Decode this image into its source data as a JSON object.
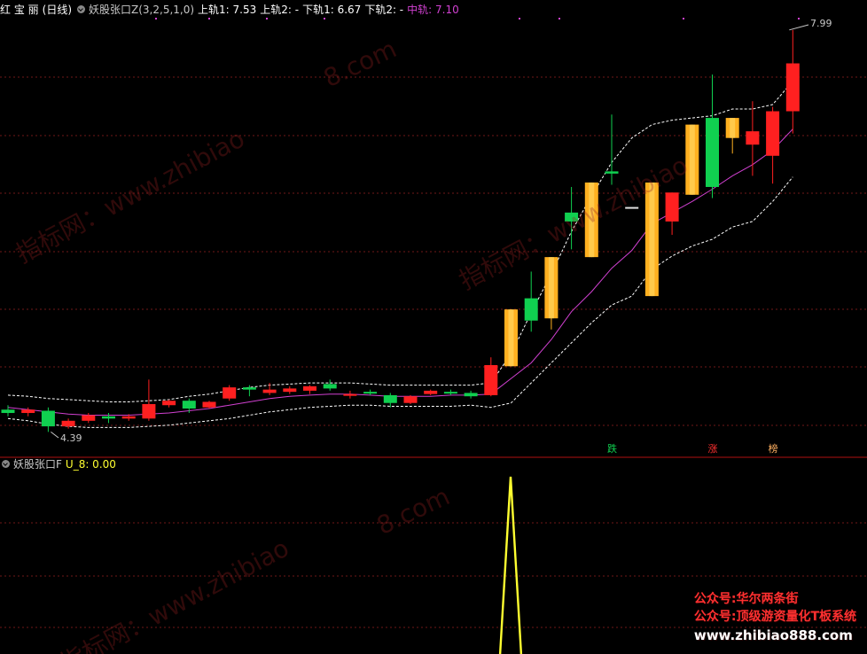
{
  "colors": {
    "up": "#ff2020",
    "down": "#10d050",
    "limit_up": "#ffb020",
    "mid": "#d040d0",
    "band": "#ffffff",
    "grid": "#701818",
    "divider": "#b01010",
    "signal_line": "#ffff30",
    "label_grey": "#c8c8c8"
  },
  "main_header": {
    "stock_name": "红 宝 丽",
    "period": "(日线)",
    "indicator": "妖股张口Z(3,2,5,1,0)",
    "upper1": "上轨1: 7.53",
    "upper2": "上轨2: -",
    "lower1": "下轨1: 6.67",
    "lower2": "下轨2: -",
    "mid": "中轨: 7.10"
  },
  "sub_header": {
    "indicator": "妖股张口F",
    "value": "U_8: 0.00"
  },
  "price_labels": {
    "high": "7.99",
    "low": "4.39"
  },
  "signals": [
    {
      "text": "跌",
      "color": "#10d050",
      "candle": 30
    },
    {
      "text": "涨",
      "color": "#ff3030",
      "candle": 35
    },
    {
      "text": "榜",
      "color": "#ffb060",
      "candle": 38
    }
  ],
  "watermarks": [
    "指标网：www.zhibiao",
    "8.com"
  ],
  "promo": [
    {
      "text": "公众号:华尔两条街",
      "color": "#ff3030"
    },
    {
      "text": "公众号:顶级游资量化T板系统",
      "color": "#ff3030"
    },
    {
      "text": "www.zhibiao888.com",
      "color": "#ffffff"
    }
  ],
  "chart_data": {
    "type": "candlestick",
    "ylim": [
      4.2,
      8.1
    ],
    "candles": [
      {
        "o": 4.58,
        "h": 4.62,
        "l": 4.52,
        "c": 4.55,
        "t": "down"
      },
      {
        "o": 4.55,
        "h": 4.6,
        "l": 4.52,
        "c": 4.58,
        "t": "up"
      },
      {
        "o": 4.57,
        "h": 4.6,
        "l": 4.38,
        "c": 4.43,
        "t": "down"
      },
      {
        "o": 4.43,
        "h": 4.5,
        "l": 4.41,
        "c": 4.48,
        "t": "up"
      },
      {
        "o": 4.48,
        "h": 4.55,
        "l": 4.46,
        "c": 4.53,
        "t": "up"
      },
      {
        "o": 4.52,
        "h": 4.55,
        "l": 4.46,
        "c": 4.5,
        "t": "down"
      },
      {
        "o": 4.5,
        "h": 4.54,
        "l": 4.48,
        "c": 4.52,
        "t": "up"
      },
      {
        "o": 4.5,
        "h": 4.85,
        "l": 4.48,
        "c": 4.63,
        "t": "up"
      },
      {
        "o": 4.62,
        "h": 4.67,
        "l": 4.6,
        "c": 4.66,
        "t": "up"
      },
      {
        "o": 4.66,
        "h": 4.68,
        "l": 4.55,
        "c": 4.59,
        "t": "down"
      },
      {
        "o": 4.6,
        "h": 4.66,
        "l": 4.59,
        "c": 4.65,
        "t": "up"
      },
      {
        "o": 4.68,
        "h": 4.8,
        "l": 4.66,
        "c": 4.78,
        "t": "up"
      },
      {
        "o": 4.78,
        "h": 4.8,
        "l": 4.7,
        "c": 4.76,
        "t": "down"
      },
      {
        "o": 4.73,
        "h": 4.82,
        "l": 4.71,
        "c": 4.76,
        "t": "up"
      },
      {
        "o": 4.74,
        "h": 4.79,
        "l": 4.72,
        "c": 4.77,
        "t": "up"
      },
      {
        "o": 4.75,
        "h": 4.8,
        "l": 4.72,
        "c": 4.79,
        "t": "up"
      },
      {
        "o": 4.81,
        "h": 4.85,
        "l": 4.75,
        "c": 4.77,
        "t": "down"
      },
      {
        "o": 4.72,
        "h": 4.75,
        "l": 4.68,
        "c": 4.71,
        "t": "up"
      },
      {
        "o": 4.73,
        "h": 4.76,
        "l": 4.71,
        "c": 4.74,
        "t": "down"
      },
      {
        "o": 4.71,
        "h": 4.73,
        "l": 4.6,
        "c": 4.64,
        "t": "down"
      },
      {
        "o": 4.64,
        "h": 4.71,
        "l": 4.63,
        "c": 4.7,
        "t": "up"
      },
      {
        "o": 4.72,
        "h": 4.76,
        "l": 4.71,
        "c": 4.75,
        "t": "up"
      },
      {
        "o": 4.74,
        "h": 4.76,
        "l": 4.71,
        "c": 4.73,
        "t": "down"
      },
      {
        "o": 4.73,
        "h": 4.75,
        "l": 4.68,
        "c": 4.7,
        "t": "down"
      },
      {
        "o": 4.71,
        "h": 5.05,
        "l": 4.7,
        "c": 4.98,
        "t": "up"
      },
      {
        "o": 4.97,
        "h": 5.48,
        "l": 4.97,
        "c": 5.48,
        "t": "limit"
      },
      {
        "o": 5.38,
        "h": 5.82,
        "l": 5.28,
        "c": 5.58,
        "t": "down"
      },
      {
        "o": 5.4,
        "h": 5.95,
        "l": 5.3,
        "c": 5.95,
        "t": "limit"
      },
      {
        "o": 6.27,
        "h": 6.58,
        "l": 6.02,
        "c": 6.35,
        "t": "down"
      },
      {
        "o": 5.95,
        "h": 6.62,
        "l": 5.95,
        "c": 6.62,
        "t": "limit"
      },
      {
        "o": 6.7,
        "h": 7.23,
        "l": 6.6,
        "c": 6.72,
        "t": "down"
      },
      {
        "o": 6.4,
        "h": 6.4,
        "l": 6.4,
        "c": 6.4,
        "t": "flat"
      },
      {
        "o": 5.6,
        "h": 6.62,
        "l": 5.6,
        "c": 6.62,
        "t": "limit"
      },
      {
        "o": 6.27,
        "h": 6.53,
        "l": 6.15,
        "c": 6.53,
        "t": "up"
      },
      {
        "o": 6.51,
        "h": 7.14,
        "l": 6.51,
        "c": 7.14,
        "t": "limit"
      },
      {
        "o": 7.2,
        "h": 7.59,
        "l": 6.48,
        "c": 6.58,
        "t": "down"
      },
      {
        "o": 7.02,
        "h": 7.2,
        "l": 6.88,
        "c": 7.2,
        "t": "limit"
      },
      {
        "o": 7.08,
        "h": 7.35,
        "l": 6.68,
        "c": 6.96,
        "t": "up"
      },
      {
        "o": 6.86,
        "h": 7.3,
        "l": 6.61,
        "c": 7.26,
        "t": "up"
      },
      {
        "o": 7.26,
        "h": 7.99,
        "l": 7.06,
        "c": 7.69,
        "t": "up"
      }
    ],
    "mid_band": [
      4.6,
      4.58,
      4.56,
      4.54,
      4.53,
      4.53,
      4.53,
      4.54,
      4.55,
      4.57,
      4.59,
      4.62,
      4.65,
      4.68,
      4.7,
      4.71,
      4.72,
      4.72,
      4.71,
      4.7,
      4.7,
      4.7,
      4.71,
      4.71,
      4.72,
      4.86,
      5.0,
      5.21,
      5.46,
      5.64,
      5.85,
      6.01,
      6.25,
      6.35,
      6.45,
      6.56,
      6.68,
      6.78,
      6.91,
      7.1
    ],
    "upper_band": [
      4.71,
      4.7,
      4.68,
      4.67,
      4.66,
      4.65,
      4.65,
      4.66,
      4.67,
      4.7,
      4.72,
      4.75,
      4.78,
      4.8,
      4.81,
      4.82,
      4.82,
      4.82,
      4.81,
      4.8,
      4.8,
      4.8,
      4.8,
      4.8,
      4.82,
      5.08,
      5.45,
      5.8,
      6.18,
      6.5,
      6.8,
      7.02,
      7.14,
      7.18,
      7.2,
      7.22,
      7.28,
      7.28,
      7.32,
      7.53
    ],
    "lower_band": [
      4.5,
      4.48,
      4.45,
      4.43,
      4.42,
      4.42,
      4.42,
      4.43,
      4.44,
      4.46,
      4.48,
      4.5,
      4.53,
      4.56,
      4.58,
      4.6,
      4.61,
      4.62,
      4.62,
      4.61,
      4.61,
      4.61,
      4.61,
      4.62,
      4.6,
      4.64,
      4.82,
      5.0,
      5.18,
      5.36,
      5.52,
      5.6,
      5.84,
      5.96,
      6.05,
      6.11,
      6.22,
      6.27,
      6.45,
      6.67
    ],
    "sub_series": {
      "name": "U_8",
      "values": [
        0,
        0,
        0,
        0,
        0,
        0,
        0,
        0,
        0,
        0,
        0,
        0,
        0,
        0,
        0,
        0,
        0,
        0,
        0,
        0,
        0,
        0,
        0,
        0,
        0,
        1,
        0,
        0,
        0,
        0,
        0,
        0,
        0,
        0,
        0,
        0,
        0,
        0,
        0,
        0
      ],
      "ylim": [
        0,
        1
      ]
    }
  }
}
